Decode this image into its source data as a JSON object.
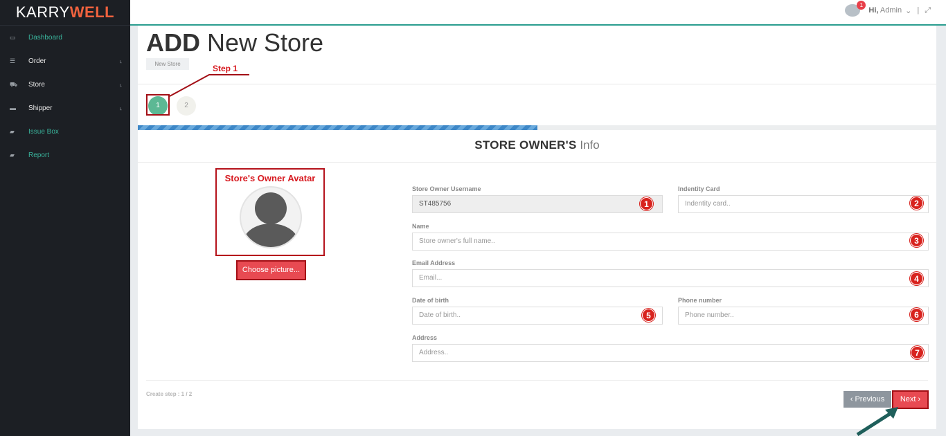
{
  "brand": {
    "part1": "KARRY",
    "part2": "WELL"
  },
  "sidebar": {
    "items": [
      {
        "label": "Dashboard",
        "icon": "laptop-icon",
        "teal": true,
        "chevron": false
      },
      {
        "label": "Order",
        "icon": "list-icon",
        "teal": false,
        "chevron": true
      },
      {
        "label": "Store",
        "icon": "cart-icon",
        "teal": false,
        "chevron": true
      },
      {
        "label": "Shipper",
        "icon": "truck-icon",
        "teal": false,
        "chevron": true
      },
      {
        "label": "Issue Box",
        "icon": "book-icon",
        "teal": true,
        "chevron": false
      },
      {
        "label": "Report",
        "icon": "book-icon",
        "teal": true,
        "chevron": false
      }
    ],
    "chevron_glyph": "˪"
  },
  "topbar": {
    "notification_count": "1",
    "greeting_hi": "Hi,",
    "greeting_name": " Admin",
    "dropdown_glyph": "⌄",
    "separator": "|",
    "expand_glyph": "⤢"
  },
  "page": {
    "title_bold": "ADD",
    "title_rest": " New Store",
    "breadcrumb": "New Store"
  },
  "wizard": {
    "steps": [
      "1",
      "2"
    ],
    "current_step": 1,
    "progress_fraction": 0.5,
    "annotation": "Step 1"
  },
  "section": {
    "title_bold": "STORE OWNER'S",
    "title_rest": " Info"
  },
  "avatar": {
    "label": "Store's Owner Avatar",
    "choose_button": "Choose picture..."
  },
  "form": {
    "username": {
      "label": "Store Owner Username",
      "value": "ST485756",
      "badge": "1"
    },
    "identity": {
      "label": "Indentity Card",
      "placeholder": "Indentity card..",
      "badge": "2"
    },
    "name": {
      "label": "Name",
      "placeholder": "Store owner's full name..",
      "badge": "3"
    },
    "email": {
      "label": "Email Address",
      "placeholder": "Email...",
      "badge": "4"
    },
    "dob": {
      "label": "Date of birth",
      "placeholder": "Date of birth..",
      "badge": "5"
    },
    "phone": {
      "label": "Phone number",
      "placeholder": "Phone number..",
      "badge": "6"
    },
    "address": {
      "label": "Address",
      "placeholder": "Address..",
      "badge": "7"
    }
  },
  "footer": {
    "create_step": "Create step : 1 / 2",
    "previous": "‹ Previous",
    "next": "Next ›"
  },
  "colors": {
    "accent_teal": "#2a9d8f",
    "brand_orange": "#f0623e",
    "annotation_red": "#d7191f",
    "button_red": "#e84a52",
    "step_active": "#5cb894",
    "progress_blue": "#3d87c7"
  }
}
